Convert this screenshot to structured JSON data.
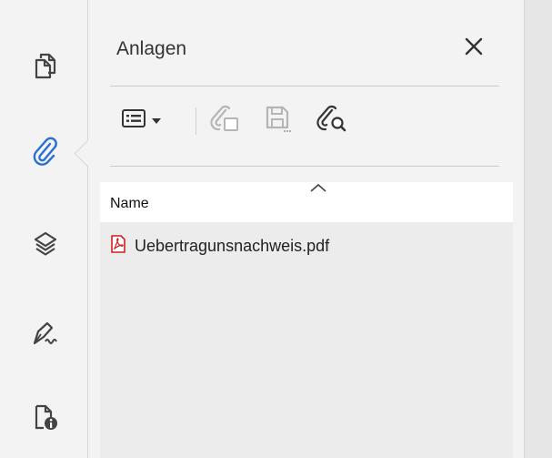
{
  "rail": {
    "items": [
      {
        "name": "pages",
        "icon": "pages-icon"
      },
      {
        "name": "attachments",
        "icon": "paperclip-icon",
        "active": true
      },
      {
        "name": "layers",
        "icon": "layers-icon"
      },
      {
        "name": "signatures",
        "icon": "signature-pen-icon"
      },
      {
        "name": "document-info",
        "icon": "document-info-icon"
      }
    ],
    "active_color": "#2a6fd6"
  },
  "panel": {
    "title": "Anlagen",
    "close_icon": "close-icon",
    "toolbar": {
      "options_icon": "list-options-icon",
      "dropdown_icon": "caret-down-icon",
      "add_icon": "add-attachment-icon",
      "save_icon": "save-attachment-icon",
      "search_icon": "search-attachment-icon"
    },
    "list": {
      "column_header": "Name",
      "sort_icon": "sort-chevron-up-icon",
      "files": [
        {
          "name": "Uebertragunsnachweis.pdf",
          "icon": "pdf-file-icon"
        }
      ]
    }
  }
}
